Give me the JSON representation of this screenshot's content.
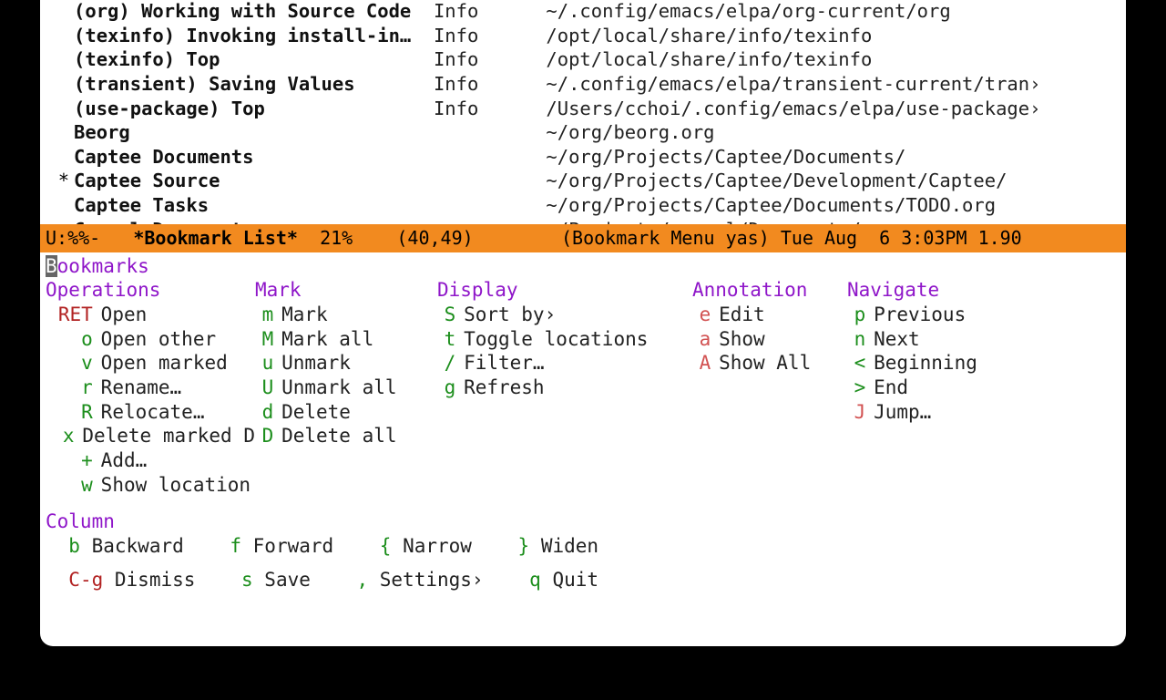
{
  "bookmarks": [
    {
      "mark": "",
      "name": "(org) Working with Source Code",
      "file_label": "Info",
      "path": "~/.config/emacs/elpa/org-current/org"
    },
    {
      "mark": "",
      "name": "(texinfo) Invoking install-in…",
      "file_label": "Info",
      "path": "/opt/local/share/info/texinfo"
    },
    {
      "mark": "",
      "name": "(texinfo) Top",
      "file_label": "Info",
      "path": "/opt/local/share/info/texinfo"
    },
    {
      "mark": "",
      "name": "(transient) Saving Values",
      "file_label": "Info",
      "path": "~/.config/emacs/elpa/transient-current/tran",
      "trunc": true
    },
    {
      "mark": "",
      "name": "(use-package) Top",
      "file_label": "Info",
      "path": "/Users/cchoi/.config/emacs/elpa/use-package",
      "trunc": true
    },
    {
      "mark": "",
      "name": "Beorg",
      "file_label": "",
      "path": "~/org/beorg.org"
    },
    {
      "mark": "",
      "name": "Captee Documents",
      "file_label": "",
      "path": "~/org/Projects/Captee/Documents/"
    },
    {
      "mark": "*",
      "name": "Captee Source",
      "file_label": "",
      "path": "~/org/Projects/Captee/Development/Captee/"
    },
    {
      "mark": "",
      "name": "Captee Tasks",
      "file_label": "",
      "path": "~/org/Projects/Captee/Documents/TODO.org"
    },
    {
      "mark": "",
      "name": "Casual Documents",
      "file_label": "",
      "path": "~/Projects/casual/Documents/",
      "cut": true
    }
  ],
  "modeline": {
    "left": "U:%%-",
    "buffer": "*Bookmark List*",
    "percent": "21%",
    "pos": "(40,49)",
    "mode": "(Bookmark Menu yas)",
    "time": "Tue Aug  6 3:03PM",
    "load": "1.90"
  },
  "panel": {
    "title_first": "B",
    "title_rest": "ookmarks",
    "headings": {
      "operations": "Operations",
      "mark": "Mark",
      "display": "Display",
      "annotation": "Annotation",
      "navigate": "Navigate",
      "column": "Column"
    },
    "operations": [
      {
        "key": "RET",
        "label": "Open",
        "cls": "key-red"
      },
      {
        "key": "o",
        "label": "Open other",
        "cls": "key"
      },
      {
        "key": "v",
        "label": "Open marked",
        "cls": "key"
      },
      {
        "key": "r",
        "label": "Rename…",
        "cls": "key"
      },
      {
        "key": "R",
        "label": "Relocate…",
        "cls": "key"
      },
      {
        "key": "x",
        "label": "Delete marked D",
        "cls": "key"
      },
      {
        "key": "+",
        "label": "Add…",
        "cls": "key"
      },
      {
        "key": "w",
        "label": "Show location",
        "cls": "key"
      }
    ],
    "mark": [
      {
        "key": "m",
        "label": "Mark",
        "cls": "key"
      },
      {
        "key": "M",
        "label": "Mark all",
        "cls": "key"
      },
      {
        "key": "u",
        "label": "Unmark",
        "cls": "key"
      },
      {
        "key": "U",
        "label": "Unmark all",
        "cls": "key"
      },
      {
        "key": "d",
        "label": "Delete",
        "cls": "key"
      },
      {
        "key": "D",
        "label": "Delete all",
        "cls": "key"
      }
    ],
    "display": [
      {
        "key": "S",
        "label": "Sort by›",
        "cls": "key"
      },
      {
        "key": "t",
        "label": "Toggle locations",
        "cls": "key"
      },
      {
        "key": "/",
        "label": "Filter…",
        "cls": "key"
      },
      {
        "key": "g",
        "label": "Refresh",
        "cls": "key"
      }
    ],
    "annotation": [
      {
        "key": "e",
        "label": "Edit",
        "cls": "key-salmon"
      },
      {
        "key": "a",
        "label": "Show",
        "cls": "key-salmon"
      },
      {
        "key": "A",
        "label": "Show All",
        "cls": "key-salmon"
      }
    ],
    "navigate": [
      {
        "key": "p",
        "label": "Previous",
        "cls": "key"
      },
      {
        "key": "n",
        "label": "Next",
        "cls": "key"
      },
      {
        "key": "<",
        "label": "Beginning",
        "cls": "key"
      },
      {
        "key": ">",
        "label": "End",
        "cls": "key"
      },
      {
        "key": "J",
        "label": "Jump…",
        "cls": "key-salmon"
      }
    ],
    "column": [
      {
        "key": "b",
        "label": "Backward",
        "cls": "key"
      },
      {
        "key": "f",
        "label": "Forward",
        "cls": "key"
      },
      {
        "key": "{",
        "label": "Narrow",
        "cls": "key"
      },
      {
        "key": "}",
        "label": "Widen",
        "cls": "key"
      }
    ],
    "footer": [
      {
        "key": "C-g",
        "label": "Dismiss",
        "cls": "key-red"
      },
      {
        "key": "s",
        "label": "Save",
        "cls": "key"
      },
      {
        "key": ",",
        "label": "Settings›",
        "cls": "key"
      },
      {
        "key": "q",
        "label": "Quit",
        "cls": "key"
      }
    ]
  }
}
